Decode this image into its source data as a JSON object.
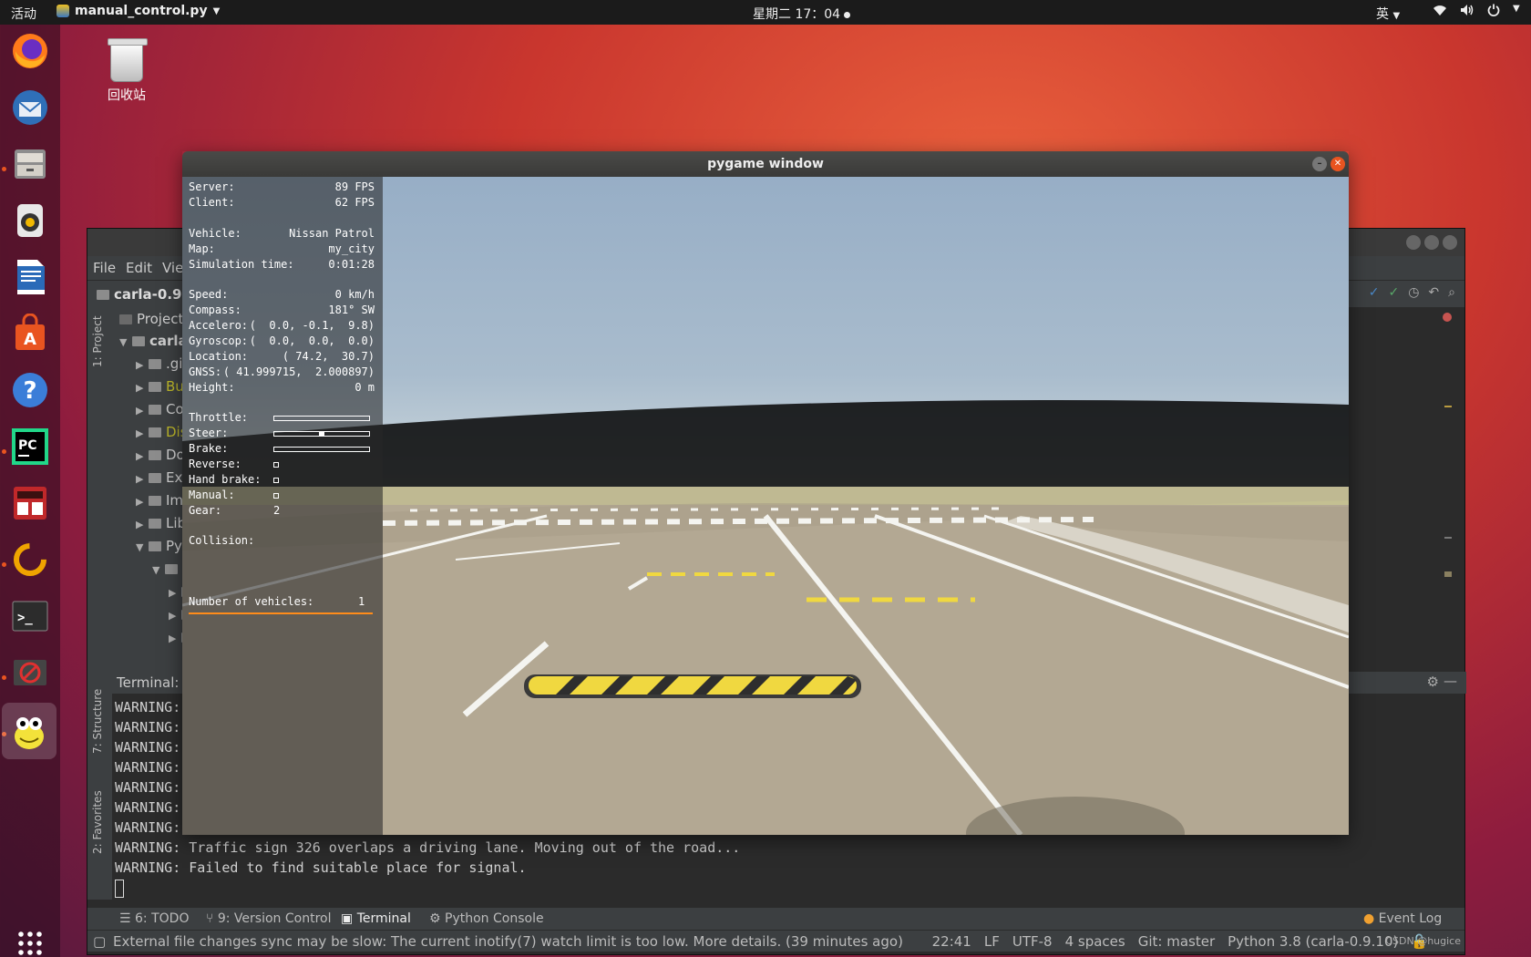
{
  "topbar": {
    "activities": "活动",
    "app_name": "manual_control.py",
    "clock": "星期二 17：04",
    "input_method": "英"
  },
  "desktop": {
    "trash_label": "回收站"
  },
  "ide": {
    "menu": [
      "File",
      "Edit",
      "Vie"
    ],
    "breadcrumb": "carla-0.9.1",
    "project_tab": "1: Project",
    "structure_tab": "7: Structure",
    "favorites_tab": "2: Favorites",
    "project_header": "Project",
    "tree": [
      {
        "label": "carla",
        "expanded": true,
        "indent": 0
      },
      {
        "label": ".git",
        "expanded": false,
        "indent": 1
      },
      {
        "label": "Bu",
        "expanded": false,
        "indent": 1,
        "color": "#bbb529"
      },
      {
        "label": "Co",
        "expanded": false,
        "indent": 1
      },
      {
        "label": "Dis",
        "expanded": false,
        "indent": 1,
        "color": "#bbb529"
      },
      {
        "label": "Do",
        "expanded": false,
        "indent": 1
      },
      {
        "label": "Exa",
        "expanded": false,
        "indent": 1
      },
      {
        "label": "Im",
        "expanded": false,
        "indent": 1
      },
      {
        "label": "Lib",
        "expanded": false,
        "indent": 1
      },
      {
        "label": "Pyt",
        "expanded": true,
        "indent": 1
      },
      {
        "label": "c",
        "expanded": true,
        "indent": 2
      },
      {
        "label": "",
        "expanded": false,
        "indent": 3
      },
      {
        "label": "",
        "expanded": false,
        "indent": 3
      },
      {
        "label": "",
        "expanded": false,
        "indent": 3
      }
    ],
    "terminal_label": "Terminal:",
    "terminal_lines": [
      "WARNING:",
      "WARNING:",
      "WARNING:",
      "WARNING:",
      "WARNING:",
      "WARNING:",
      "WARNING: Failed to find suitable place for signal.",
      "WARNING: Traffic sign 326 overlaps a driving lane. Moving out of the road...",
      "WARNING: Failed to find suitable place for signal."
    ],
    "bottom_tabs": [
      "6: TODO",
      "9: Version Control",
      "Terminal",
      "Python Console"
    ],
    "event_log": "Event Log",
    "status_message": "External file changes sync may be slow: The current inotify(7) watch limit is too low. More details. (39 minutes ago)",
    "status_right": [
      "22:41",
      "LF",
      "UTF-8",
      "4 spaces",
      "Git: master",
      "Python 3.8 (carla-0.9.10)"
    ],
    "watermark": "CSDN @hugice"
  },
  "pygame": {
    "title": "pygame window",
    "hud": {
      "server_label": "Server:",
      "server_value": "89 FPS",
      "client_label": "Client:",
      "client_value": "62 FPS",
      "vehicle_label": "Vehicle:",
      "vehicle_value": "Nissan Patrol",
      "map_label": "Map:",
      "map_value": "my_city",
      "simtime_label": "Simulation time:",
      "simtime_value": "0:01:28",
      "speed_label": "Speed:",
      "speed_value": "0 km/h",
      "compass_label": "Compass:",
      "compass_value": "181° SW",
      "accelero_label": "Accelero:",
      "accelero_value": "(  0.0, -0.1,  9.8)",
      "gyroscop_label": "Gyroscop:",
      "gyroscop_value": "(  0.0,  0.0,  0.0)",
      "location_label": "Location:",
      "location_value": "( 74.2,  30.7)",
      "gnss_label": "GNSS:",
      "gnss_value": "( 41.999715,  2.000897)",
      "height_label": "Height:",
      "height_value": "0 m",
      "throttle_label": "Throttle:",
      "throttle": 0.0,
      "steer_label": "Steer:",
      "steer": 0.0,
      "brake_label": "Brake:",
      "brake": 0.0,
      "reverse_label": "Reverse:",
      "reverse": false,
      "handbrake_label": "Hand brake:",
      "handbrake": false,
      "manual_label": "Manual:",
      "manual": false,
      "gear_label": "Gear:",
      "gear_value": "2",
      "collision_label": "Collision:",
      "vehicles_label": "Number of vehicles:",
      "vehicles_value": "1"
    }
  },
  "colors": {
    "collision_line": "#ff8c1a",
    "ubuntu_orange": "#e95420"
  }
}
